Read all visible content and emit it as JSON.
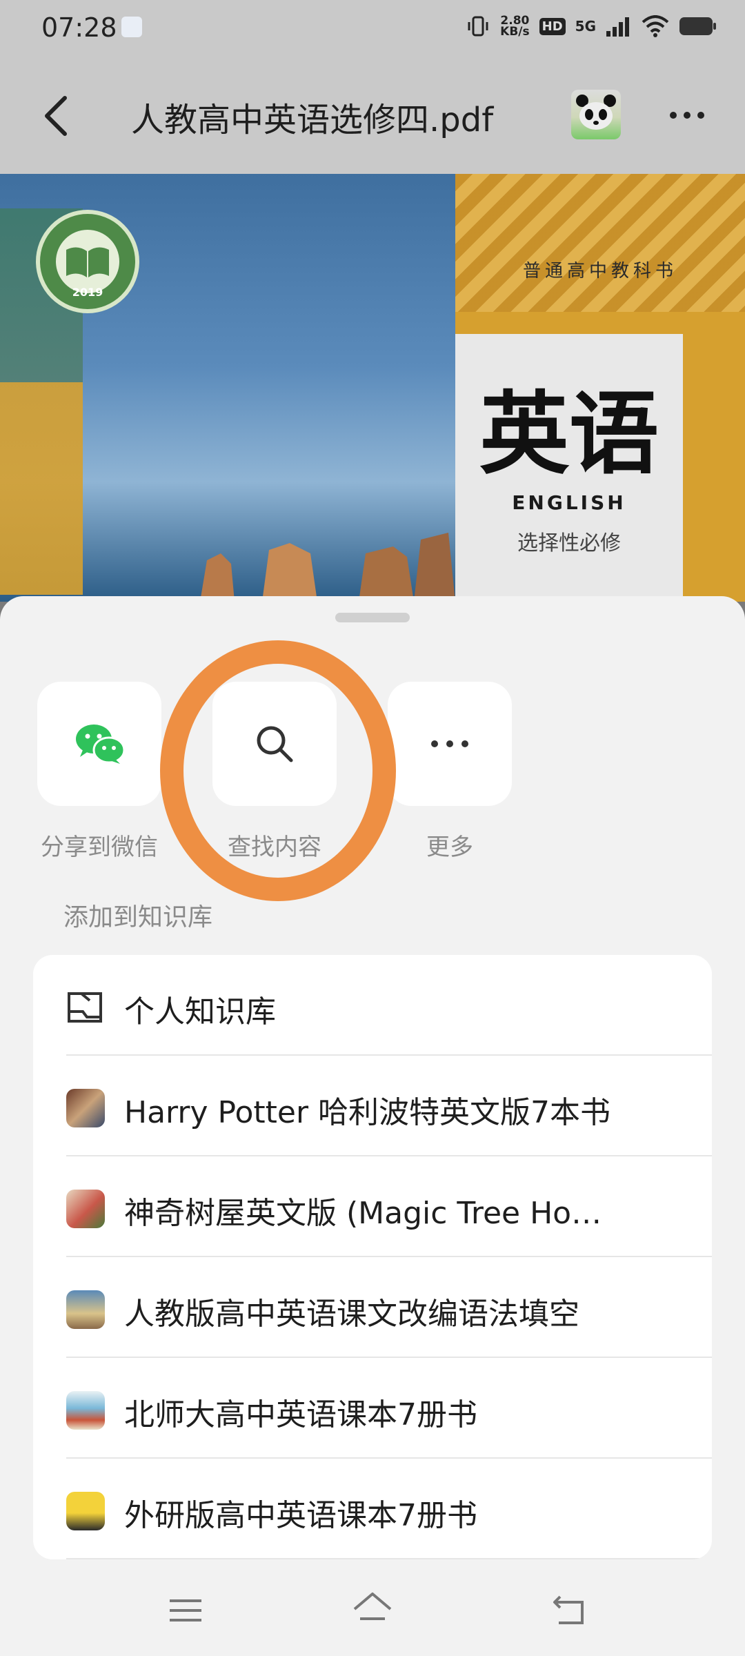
{
  "status_bar": {
    "time": "07:28",
    "speed_value": "2.80",
    "speed_unit": "KB/s",
    "hd": "HD",
    "network": "5G"
  },
  "header": {
    "title": "人教高中英语选修四.pdf"
  },
  "preview": {
    "seal_year": "2019",
    "subtitle": "普通高中教科书",
    "big_title": "英语",
    "english": "ENGLISH",
    "selective": "选择性必修"
  },
  "actions": [
    {
      "label": "分享到微信",
      "icon": "wechat-icon"
    },
    {
      "label": "查找内容",
      "icon": "search-icon"
    },
    {
      "label": "更多",
      "icon": "more-dots-icon"
    }
  ],
  "section_title": "添加到知识库",
  "knowledge_bases": [
    {
      "label": "个人知识库",
      "icon": "folder-icon"
    },
    {
      "label": "Harry Potter 哈利波特英文版7本书",
      "icon": "book-cover-thumb"
    },
    {
      "label": "神奇树屋英文版 (Magic Tree Ho…",
      "icon": "book-cover-thumb"
    },
    {
      "label": "人教版高中英语课文改编语法填空",
      "icon": "book-cover-thumb"
    },
    {
      "label": "北师大高中英语课本7册书",
      "icon": "book-cover-thumb"
    },
    {
      "label": "外研版高中英语课本7册书",
      "icon": "book-cover-thumb"
    }
  ],
  "colors": {
    "annotation_ring": "#ee8f43",
    "wechat_green": "#2fc25b"
  }
}
